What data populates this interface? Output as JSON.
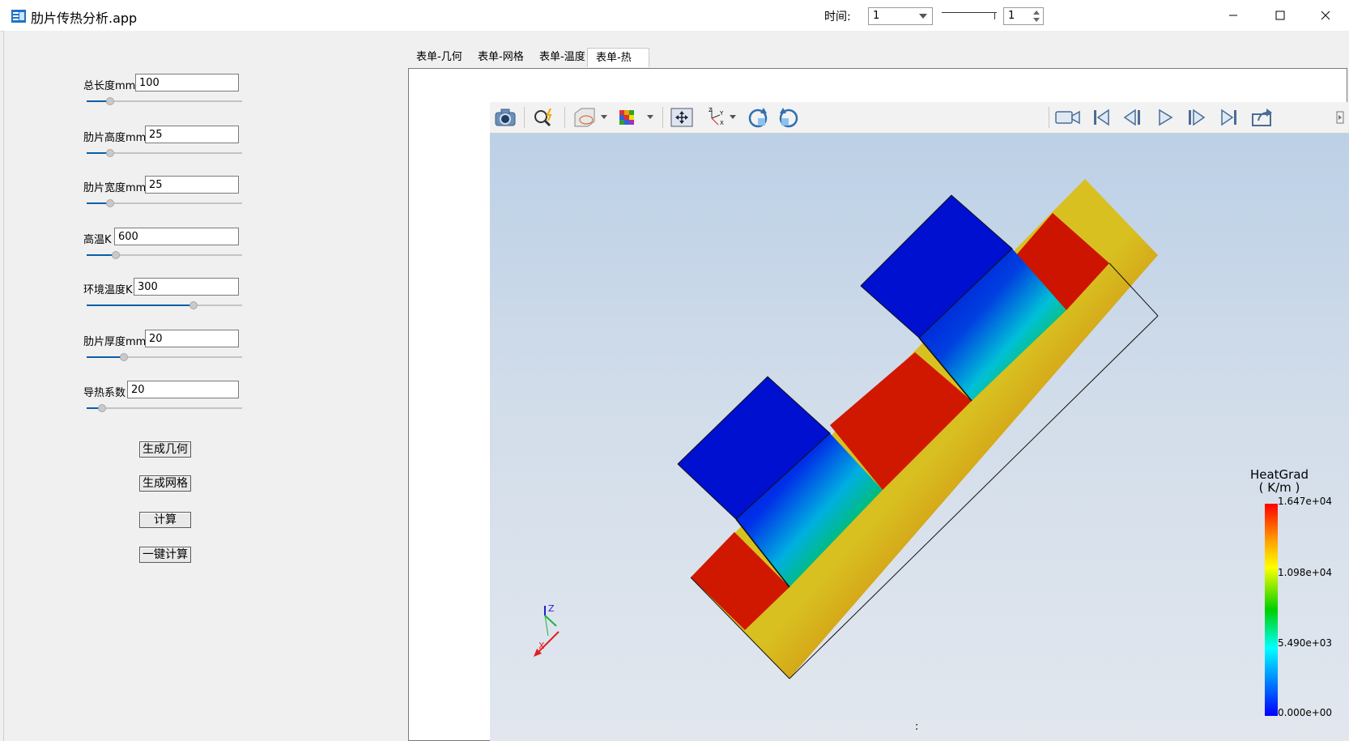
{
  "window": {
    "title": "肋片传热分析.app",
    "controls": [
      "minimize",
      "maximize",
      "close"
    ]
  },
  "params": [
    {
      "label": "总长度mm",
      "value": "100",
      "slider_fraction": 0.15
    },
    {
      "label": "肋片高度mm",
      "value": "25",
      "slider_fraction": 0.15
    },
    {
      "label": "肋片宽度mm",
      "value": "25",
      "slider_fraction": 0.15
    },
    {
      "label": "高温K",
      "value": "600",
      "slider_fraction": 0.19
    },
    {
      "label": "环境温度K",
      "value": "300",
      "slider_fraction": 0.69
    },
    {
      "label": "肋片厚度mm",
      "value": "20",
      "slider_fraction": 0.24
    },
    {
      "label": "导热系数",
      "value": "20",
      "slider_fraction": 0.1
    }
  ],
  "buttons": {
    "gen_geometry": "生成几何",
    "gen_mesh": "生成网格",
    "compute": "计算",
    "one_click": "一键计算"
  },
  "tabs": [
    {
      "label": "表单-几何",
      "active": false
    },
    {
      "label": "表单-网格",
      "active": false
    },
    {
      "label": "表单-温度",
      "active": false
    },
    {
      "label": "表单-热量",
      "active": true
    }
  ],
  "toolbar": {
    "time_label": "时间:",
    "time_value": "1",
    "frame_value": "1",
    "icons": [
      "camera-icon",
      "zoom-icon",
      "render-mode-icon",
      "colormap-icon",
      "fit-view-icon",
      "axes-icon",
      "rotate-cw-icon",
      "rotate-ccw-icon",
      "record-icon",
      "first-frame-icon",
      "prev-frame-icon",
      "play-icon",
      "next-frame-icon",
      "last-frame-icon",
      "export-icon"
    ]
  },
  "legend": {
    "title_line1": "HeatGrad",
    "title_line2": "( K/m )",
    "ticks": [
      "1.647e+04",
      "1.098e+04",
      "5.490e+03",
      "0.000e+00"
    ],
    "colors": [
      "#ff0000",
      "#ffff00",
      "#00d000",
      "#00ffff",
      "#0000ff"
    ]
  },
  "axes": {
    "z": "Z",
    "x": "X"
  },
  "status_mark": ":"
}
